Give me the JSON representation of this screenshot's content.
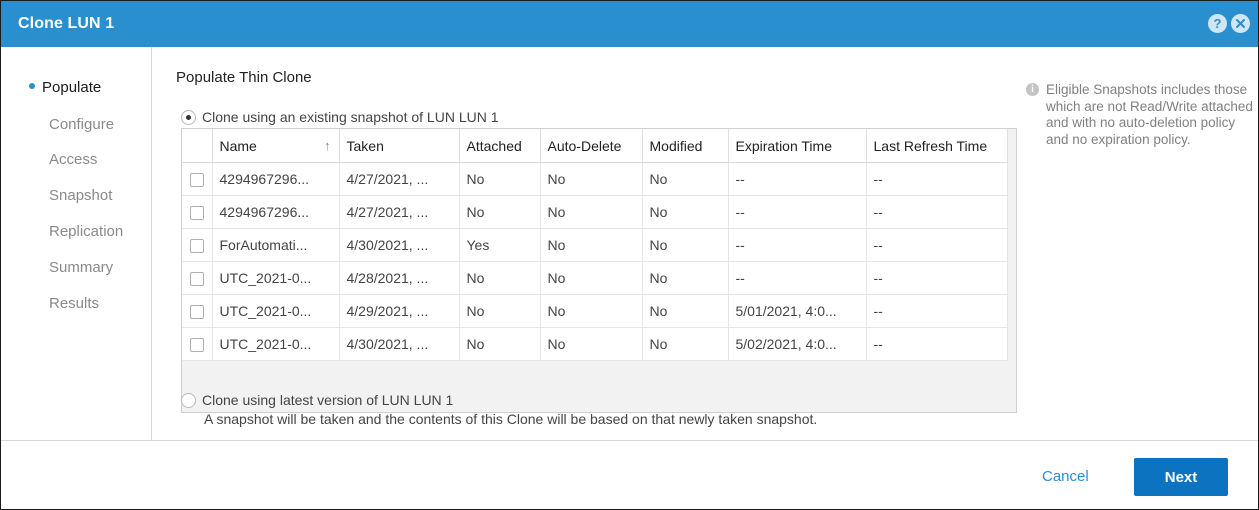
{
  "dialog": {
    "title": "Clone LUN 1"
  },
  "nav": {
    "items": [
      "Populate",
      "Configure",
      "Access",
      "Snapshot",
      "Replication",
      "Summary",
      "Results"
    ]
  },
  "main": {
    "section_title": "Populate Thin Clone",
    "option_existing": "Clone using an existing snapshot of LUN LUN 1",
    "option_latest": "Clone using latest version of LUN LUN 1",
    "option_latest_desc": "A snapshot will be taken and the contents of this Clone will be based on that newly taken snapshot.",
    "selected_option": "existing"
  },
  "table": {
    "columns": [
      "Name",
      "Taken",
      "Attached",
      "Auto-Delete",
      "Modified",
      "Expiration Time",
      "Last Refresh Time"
    ],
    "rows": [
      [
        "4294967296...",
        "4/27/2021, ...",
        "No",
        "No",
        "No",
        "--",
        "--"
      ],
      [
        "4294967296...",
        "4/27/2021, ...",
        "No",
        "No",
        "No",
        "--",
        "--"
      ],
      [
        "ForAutomati...",
        "4/30/2021, ...",
        "Yes",
        "No",
        "No",
        "--",
        "--"
      ],
      [
        "UTC_2021-0...",
        "4/28/2021, ...",
        "No",
        "No",
        "No",
        "--",
        "--"
      ],
      [
        "UTC_2021-0...",
        "4/29/2021, ...",
        "No",
        "No",
        "No",
        "5/01/2021, 4:0...",
        "--"
      ],
      [
        "UTC_2021-0...",
        "4/30/2021, ...",
        "No",
        "No",
        "No",
        "5/02/2021, 4:0...",
        "--"
      ]
    ]
  },
  "info": {
    "text": "Eligible Snapshots includes those which are not Read/Write attached and with no auto-deletion policy and no expiration policy."
  },
  "footer": {
    "cancel_label": "Cancel",
    "next_label": "Next"
  },
  "icons": {
    "help": "help-icon",
    "close": "close-icon",
    "info": "info-icon",
    "sort": "sort-up-icon"
  },
  "colors": {
    "accent": "#2a8fcf",
    "primary_button": "#0b73c0"
  }
}
